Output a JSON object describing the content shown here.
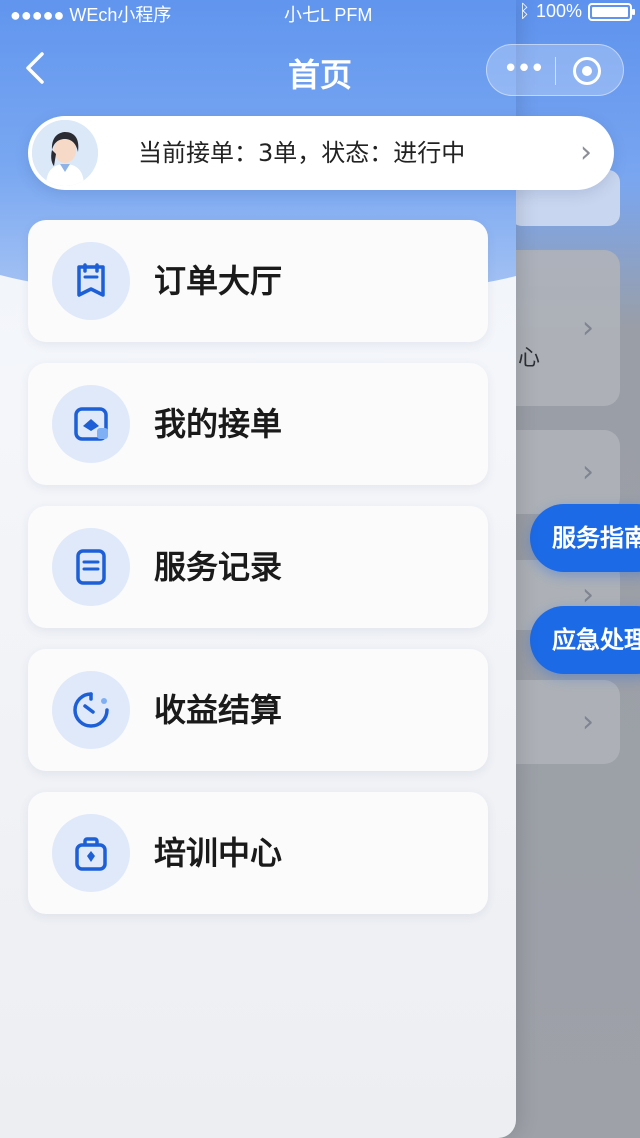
{
  "status_bar": {
    "carrier": "●●●●● WEch小程序",
    "center": "小七L PFM",
    "battery": "100%"
  },
  "header": {
    "title": "首页"
  },
  "order_status": {
    "text": "当前接单：3单，状态：进行中"
  },
  "menu": [
    {
      "label": "订单大厅",
      "icon": "order-hall-icon"
    },
    {
      "label": "我的接单",
      "icon": "my-orders-icon"
    },
    {
      "label": "服务记录",
      "icon": "service-record-icon"
    },
    {
      "label": "收益结算",
      "icon": "earnings-icon"
    },
    {
      "label": "培训中心",
      "icon": "training-icon"
    }
  ],
  "background": {
    "fragment_text": "心",
    "pill_1": "服务指南",
    "pill_2": "应急处理"
  },
  "colors": {
    "primary": "#1d6ae6",
    "header_blue": "#5e93ee",
    "icon_blue": "#1d5fd6"
  }
}
